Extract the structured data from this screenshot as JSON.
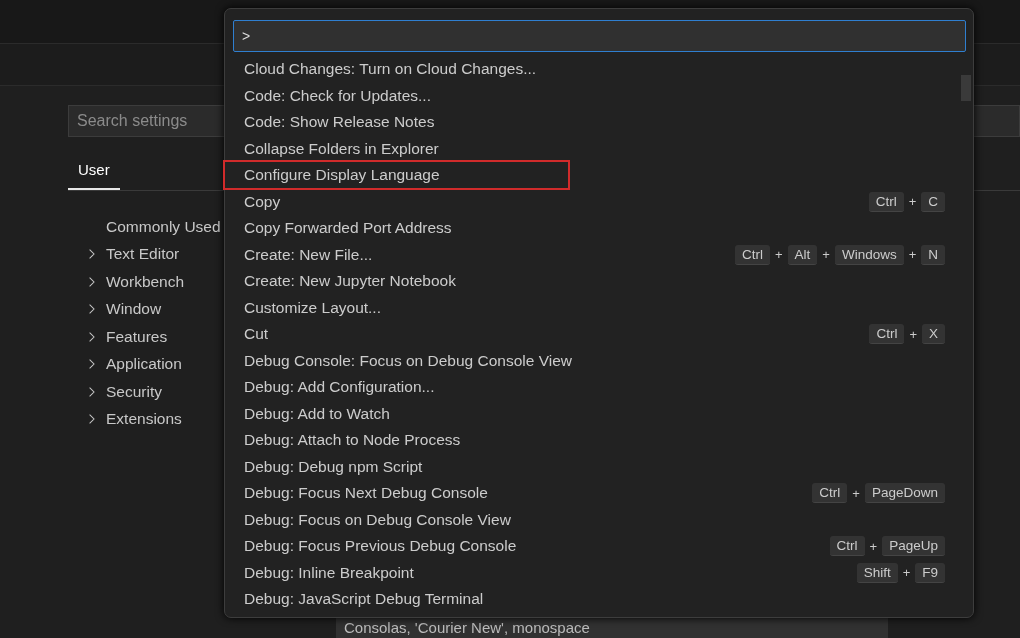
{
  "settings": {
    "search": {
      "placeholder": "Search settings"
    },
    "tabs": [
      {
        "label": "User",
        "selected": true
      }
    ],
    "tree": [
      {
        "label": "Commonly Used",
        "kind": "leaf"
      },
      {
        "label": "Text Editor",
        "kind": "group"
      },
      {
        "label": "Workbench",
        "kind": "group"
      },
      {
        "label": "Window",
        "kind": "group"
      },
      {
        "label": "Features",
        "kind": "group"
      },
      {
        "label": "Application",
        "kind": "group"
      },
      {
        "label": "Security",
        "kind": "group"
      },
      {
        "label": "Extensions",
        "kind": "group"
      }
    ],
    "font_family_value": "Consolas, 'Courier New', monospace"
  },
  "command_palette": {
    "input": {
      "value": ">"
    },
    "commands": [
      {
        "label": "Cloud Changes: Turn on Cloud Changes...",
        "marked": false
      },
      {
        "label": "Code: Check for Updates...",
        "marked": false
      },
      {
        "label": "Code: Show Release Notes",
        "marked": false
      },
      {
        "label": "Collapse Folders in Explorer",
        "marked": false
      },
      {
        "label": "Configure Display Language",
        "marked": true
      },
      {
        "label": "Copy",
        "marked": false,
        "keys": [
          "Ctrl",
          "+",
          "C"
        ]
      },
      {
        "label": "Copy Forwarded Port Address",
        "marked": false
      },
      {
        "label": "Create: New File...",
        "marked": false,
        "keys": [
          "Ctrl",
          "+",
          "Alt",
          "+",
          "Windows",
          "+",
          "N"
        ]
      },
      {
        "label": "Create: New Jupyter Notebook",
        "marked": false
      },
      {
        "label": "Customize Layout...",
        "marked": false
      },
      {
        "label": "Cut",
        "marked": false,
        "keys": [
          "Ctrl",
          "+",
          "X"
        ]
      },
      {
        "label": "Debug Console: Focus on Debug Console View",
        "marked": false
      },
      {
        "label": "Debug: Add Configuration...",
        "marked": false
      },
      {
        "label": "Debug: Add to Watch",
        "marked": false
      },
      {
        "label": "Debug: Attach to Node Process",
        "marked": false
      },
      {
        "label": "Debug: Debug npm Script",
        "marked": false
      },
      {
        "label": "Debug: Focus Next Debug Console",
        "marked": false,
        "keys": [
          "Ctrl",
          "+",
          "PageDown"
        ]
      },
      {
        "label": "Debug: Focus on Debug Console View",
        "marked": false
      },
      {
        "label": "Debug: Focus Previous Debug Console",
        "marked": false,
        "keys": [
          "Ctrl",
          "+",
          "PageUp"
        ]
      },
      {
        "label": "Debug: Inline Breakpoint",
        "marked": false,
        "keys": [
          "Shift",
          "+",
          "F9"
        ]
      },
      {
        "label": "Debug: JavaScript Debug Terminal",
        "marked": false
      }
    ]
  }
}
